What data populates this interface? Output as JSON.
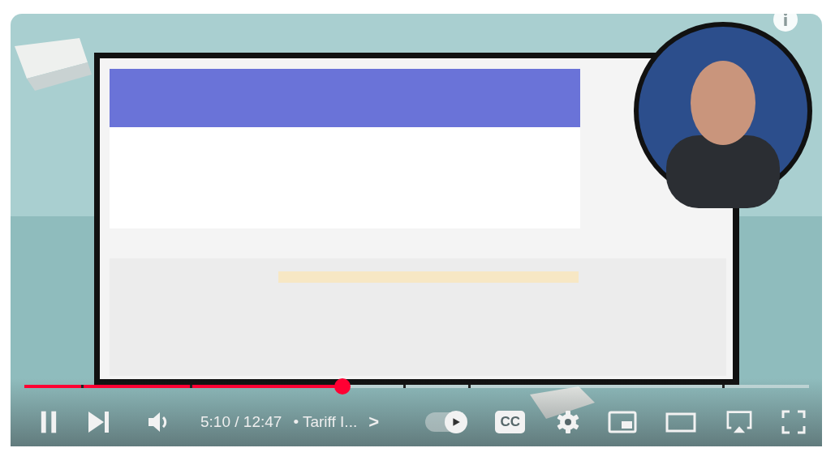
{
  "player": {
    "kind": "picture",
    "progress": {
      "level": 0.405
    },
    "playing": true,
    "time": "5:10 / 12:47",
    "chapter": "• Tariff I...",
    "chapter_chevron": ">",
    "autoplay": {
      "on": true
    },
    "captions": {
      "label": "CC"
    }
  }
}
